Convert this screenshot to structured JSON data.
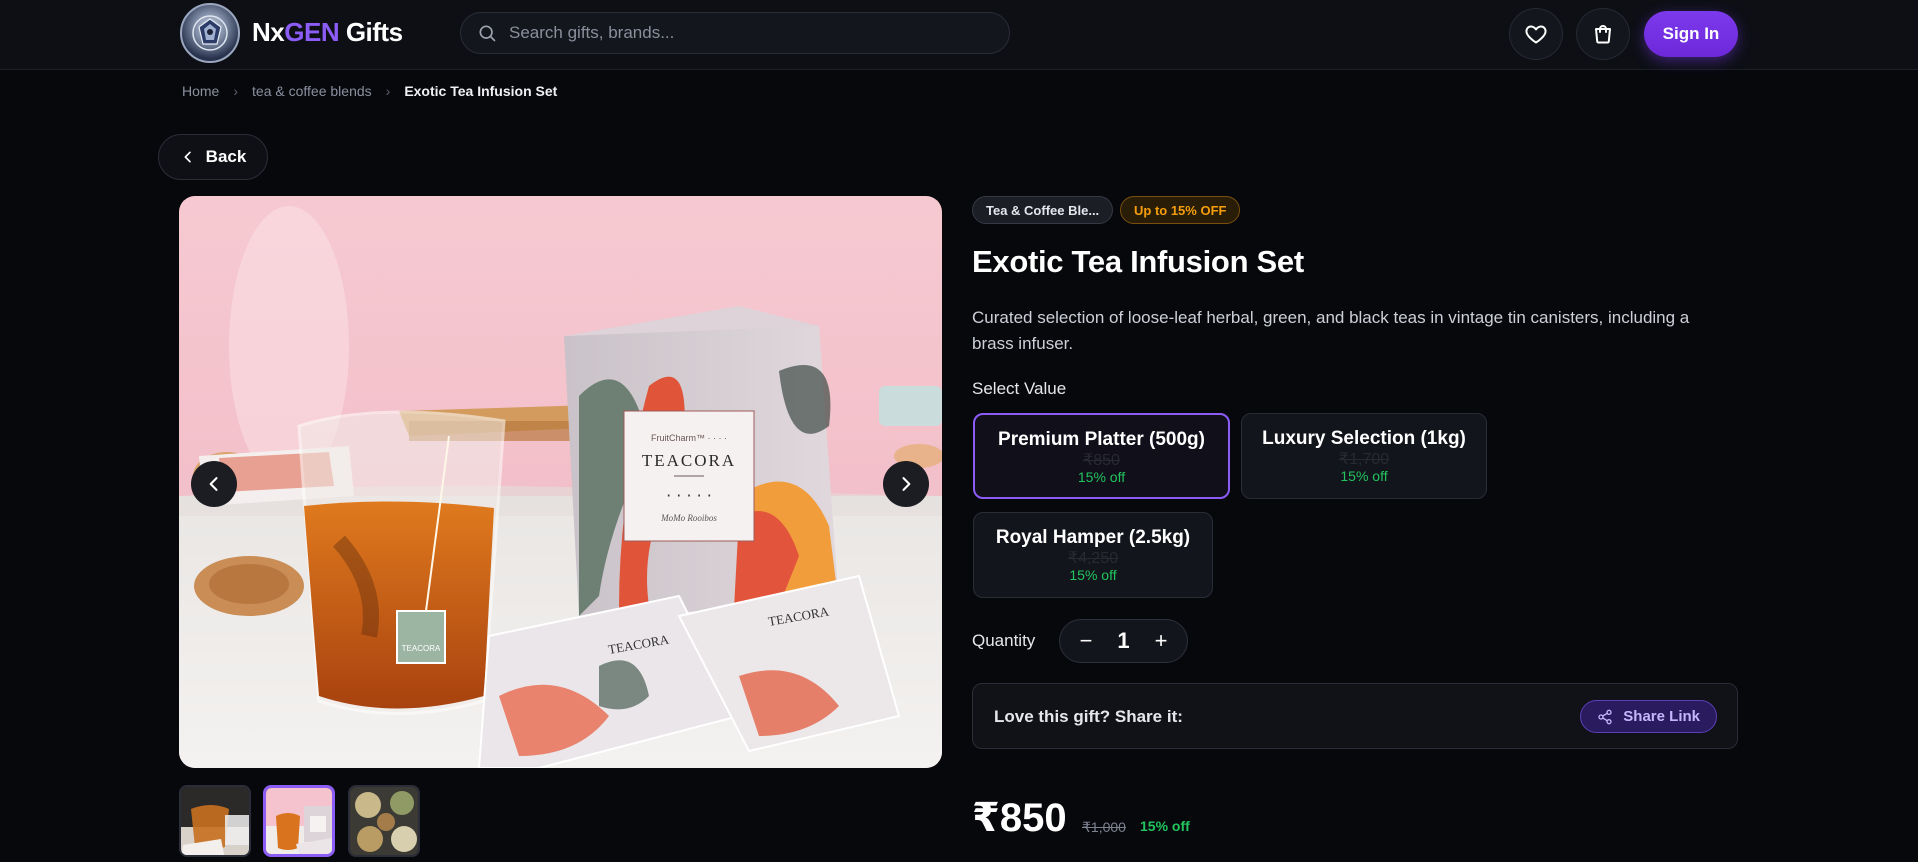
{
  "header": {
    "brand_part1": "Nx",
    "brand_part2": "GEN",
    "brand_part3": " Gifts",
    "search_placeholder": "Search gifts, brands...",
    "signin_label": "Sign In"
  },
  "breadcrumb": {
    "items": [
      "Home",
      "tea & coffee blends",
      "Exotic Tea Infusion Set"
    ]
  },
  "back_label": "Back",
  "product": {
    "category_pill": "Tea & Coffee Ble...",
    "discount_pill": "Up to 15% OFF",
    "title": "Exotic Tea Infusion Set",
    "description": "Curated selection of loose-leaf herbal, green, and black teas in vintage tin canisters, including a brass infuser.",
    "select_label": "Select Value",
    "variants": [
      {
        "name": "Premium Platter (500g)",
        "price": "₹850",
        "off": "15% off",
        "selected": true
      },
      {
        "name": "Luxury Selection (1kg)",
        "price": "₹1,700",
        "off": "15% off",
        "selected": false
      },
      {
        "name": "Royal Hamper (2.5kg)",
        "price": "₹4,250",
        "off": "15% off",
        "selected": false
      }
    ],
    "quantity_label": "Quantity",
    "quantity_value": "1",
    "share_text": "Love this gift? Share it:",
    "share_button": "Share Link",
    "price": "₹850",
    "original_price": "₹1,000",
    "price_off": "15% off",
    "thumbnails_selected_index": 1
  },
  "colors": {
    "accent": "#7c3aed",
    "success": "#22c55e",
    "warning": "#f59e0b",
    "background": "#07080c"
  },
  "icons": [
    "search-icon",
    "heart-icon",
    "cart-icon",
    "chevron-left-icon",
    "chevron-right-icon",
    "minus-icon",
    "plus-icon",
    "share-icon"
  ]
}
